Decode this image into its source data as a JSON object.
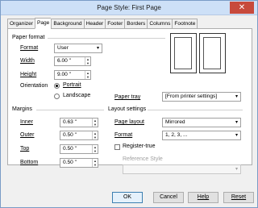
{
  "window": {
    "title": "Page Style: First Page",
    "close_glyph": "✕"
  },
  "tabs": [
    "Organizer",
    "Page",
    "Background",
    "Header",
    "Footer",
    "Borders",
    "Columns",
    "Footnote"
  ],
  "paper_format": {
    "section_label": "Paper format",
    "format_label": "Format",
    "format_value": "User",
    "width_label": "Width",
    "width_value": "6.00 \"",
    "height_label": "Height",
    "height_value": "9.00 \"",
    "orientation_label": "Orientation",
    "portrait_label": "Portrait",
    "landscape_label": "Landscape",
    "orientation_selected": "portrait",
    "paper_tray_label": "Paper tray",
    "paper_tray_value": "[From printer settings]"
  },
  "margins": {
    "section_label": "Margins",
    "inner_label": "Inner",
    "inner_value": "0.63 \"",
    "outer_label": "Outer",
    "outer_value": "0.50 \"",
    "top_label": "Top",
    "top_value": "0.50 \"",
    "bottom_label": "Bottom",
    "bottom_value": "0.50 \""
  },
  "layout_settings": {
    "section_label": "Layout settings",
    "page_layout_label": "Page layout",
    "page_layout_value": "Mirrored",
    "format_label": "Format",
    "format_value": "1, 2, 3, ...",
    "register_true_label": "Register-true",
    "register_true_checked": false,
    "reference_style_label": "Reference Style",
    "reference_style_value": ""
  },
  "buttons": {
    "ok": "OK",
    "cancel": "Cancel",
    "help": "Help",
    "reset": "Reset"
  },
  "icons": {
    "dropdown": "▾",
    "spin_up": "▲",
    "spin_down": "▼"
  }
}
